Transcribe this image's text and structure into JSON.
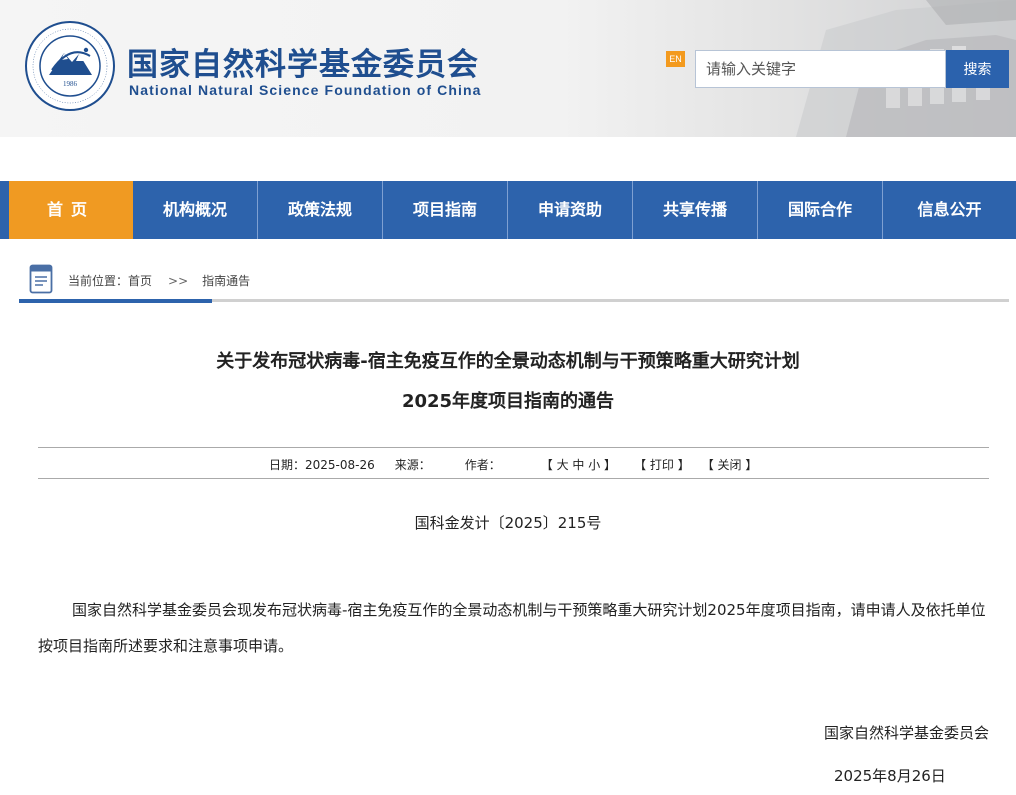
{
  "header": {
    "org_cn": "国家自然科学基金委员会",
    "org_en": "National Natural Science Foundation of China",
    "logo_year": "1986",
    "en_toggle": "EN",
    "search": {
      "placeholder": "请输入关键字",
      "button": "搜索"
    }
  },
  "nav": {
    "items": [
      {
        "label": "首页",
        "active": true
      },
      {
        "label": "机构概况"
      },
      {
        "label": "政策法规"
      },
      {
        "label": "项目指南"
      },
      {
        "label": "申请资助"
      },
      {
        "label": "共享传播"
      },
      {
        "label": "国际合作"
      },
      {
        "label": "信息公开"
      }
    ]
  },
  "breadcrumb": {
    "prefix": "当前位置：",
    "home": "首页",
    "separator": ">>",
    "current": "指南通告"
  },
  "article": {
    "title_line1": "关于发布冠状病毒-宿主免疫互作的全景动态机制与干预策略重大研究计划",
    "title_line2": "2025年度项目指南的通告",
    "meta": {
      "date_label": "日期：",
      "date": "2025-08-26",
      "source_label": "来源：",
      "author_label": "作者：",
      "font_size_control": "【 大 中 小 】",
      "print": "【 打印 】",
      "close": "【 关闭 】"
    },
    "doc_number": "国科金发计〔2025〕215号",
    "body": "国家自然科学基金委员会现发布冠状病毒-宿主免疫互作的全景动态机制与干预策略重大研究计划2025年度项目指南，请申请人及依托单位按项目指南所述要求和注意事项申请。",
    "signature_org": "国家自然科学基金委员会",
    "signature_date": "2025年8月26日"
  },
  "colors": {
    "brand_blue": "#2d63ac",
    "active_orange": "#f09a22",
    "title_blue": "#1f4e8f"
  }
}
